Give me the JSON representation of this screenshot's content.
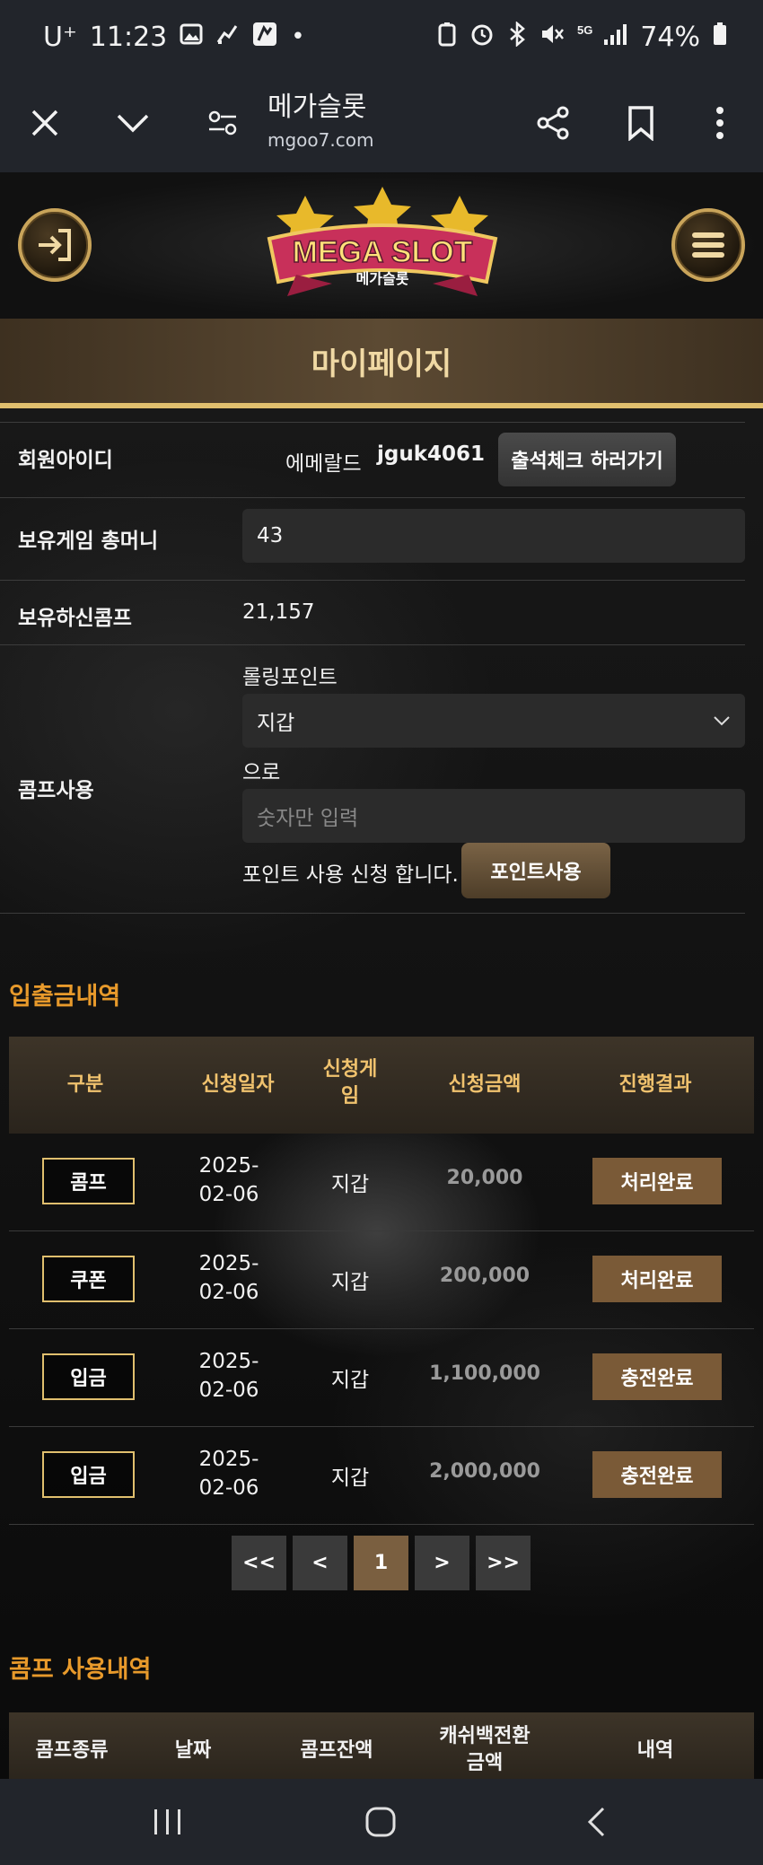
{
  "status_bar": {
    "carrier": "U⁺",
    "time": "11:23",
    "battery": "74%"
  },
  "browser": {
    "title": "메가슬롯",
    "domain": "mgoo7.com"
  },
  "logo": {
    "text": "MEGA SLOT",
    "subtext": "메가슬롯"
  },
  "page_title": "마이페이지",
  "member": {
    "id_label": "회원아이디",
    "level": "에메랄드",
    "user_id": "jguk4061",
    "attend_button": "출석체크 하러가기",
    "money_label": "보유게임 총머니",
    "money_value": "43",
    "comp_label": "보유하신콤프",
    "comp_value": "21,157",
    "use_label": "콤프사용",
    "rolling_label": "롤링포인트",
    "wallet_selected": "지갑",
    "to_label": "으로",
    "amount_placeholder": "숫자만 입력",
    "apply_text": "포인트 사용 신청 합니다.",
    "points_button": "포인트사용"
  },
  "transactions": {
    "title": "입출금내역",
    "headers": [
      "구분",
      "신청일자",
      "신청게임",
      "신청금액",
      "진행결과"
    ],
    "header_game_line1": "신청게",
    "header_game_line2": "임",
    "rows": [
      {
        "type": "콤프",
        "date1": "2025-",
        "date2": "02-06",
        "game": "지갑",
        "amount": "20,000",
        "result": "처리완료"
      },
      {
        "type": "쿠폰",
        "date1": "2025-",
        "date2": "02-06",
        "game": "지갑",
        "amount": "200,000",
        "result": "처리완료"
      },
      {
        "type": "입금",
        "date1": "2025-",
        "date2": "02-06",
        "game": "지갑",
        "amount": "1,100,000",
        "result": "충전완료"
      },
      {
        "type": "입금",
        "date1": "2025-",
        "date2": "02-06",
        "game": "지갑",
        "amount": "2,000,000",
        "result": "충전완료"
      }
    ]
  },
  "pager": {
    "first": "<<",
    "prev": "<",
    "current": "1",
    "next": ">",
    "last": ">>"
  },
  "comp_history": {
    "title": "콤프 사용내역",
    "h1": "콤프종류",
    "h2": "날짜",
    "h3": "콤프잔액",
    "h4_line1": "캐쉬백전환",
    "h4_line2": "금액",
    "h5": "내역"
  },
  "colors": {
    "accent_orange": "#e89a2b",
    "gold": "#e0bf6e",
    "status_brown": "#7a5a37"
  }
}
